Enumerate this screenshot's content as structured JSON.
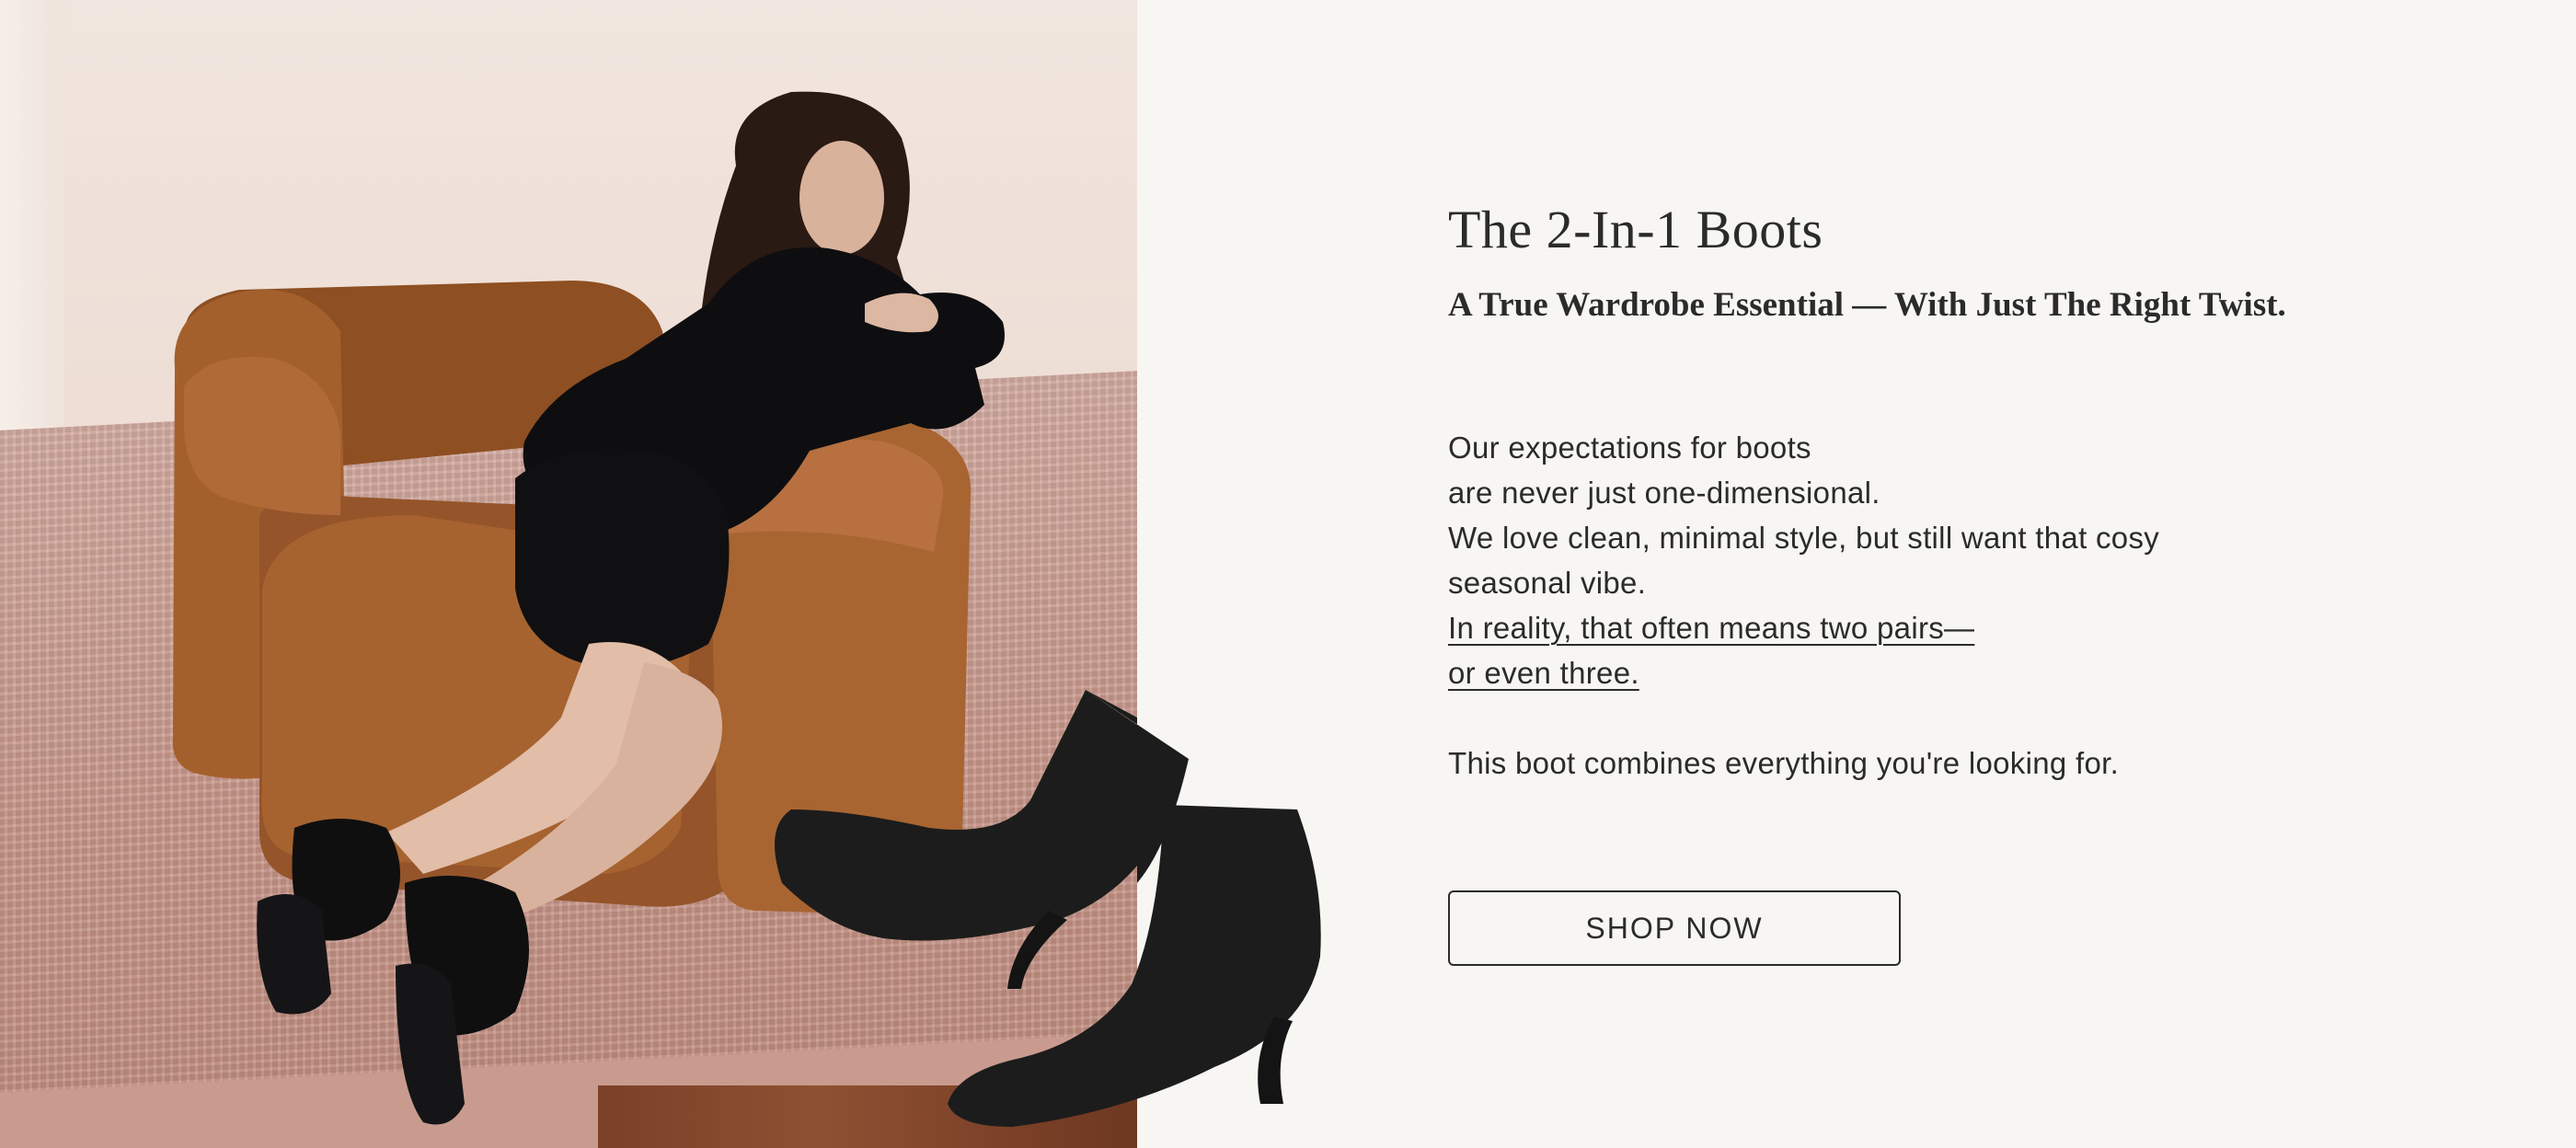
{
  "hero": {
    "title": "The 2-In-1 Boots",
    "subtitle": "A True Wardrobe Essential — With Just The Right Twist.",
    "body_lines": [
      "Our expectations for boots",
      "are never just one-dimensional.",
      "We love clean, minimal style, but still want that cosy",
      "seasonal vibe."
    ],
    "link_lines": [
      "In reality, that often means two pairs—",
      "or even three."
    ],
    "closing_line": "This boot combines everything you're looking for.",
    "cta_label": "SHOP NOW"
  },
  "colors": {
    "background": "#f7f6f3",
    "text": "#2b2b2b",
    "armchair": "#9a5a2a",
    "boot": "#1c1c1c"
  }
}
